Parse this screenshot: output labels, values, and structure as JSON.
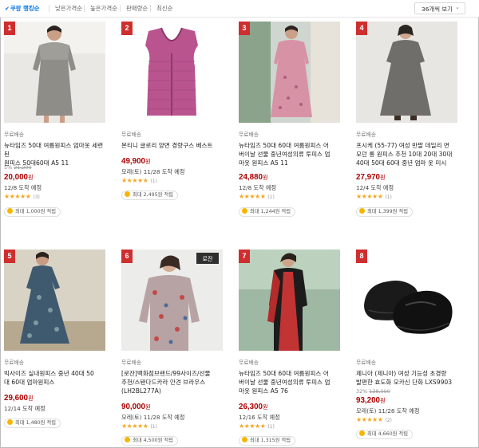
{
  "sort": {
    "options": [
      "쿠팡 랭킹순",
      "낮은가격순",
      "높은가격순",
      "판매량순",
      "최신순"
    ],
    "selected": "쿠팡 랭킹순",
    "per_page": "36개씩 보기"
  },
  "colors": {
    "accent": "#0073e9",
    "price": "#ae0000",
    "rank_badge": "#cf2e2e",
    "star": "#f5a623"
  },
  "products": [
    {
      "rank": "1",
      "shipping": "무료배송",
      "name": "뉴타임즈 50대 여름원피스 엄마옷 세련된\n원피스 50대60대 A5 11",
      "discount_pct": "5%",
      "original_price": "21,200",
      "price": "20,000",
      "won": "원",
      "delivery": "12/8 도착 예정",
      "stars": "★★★★★",
      "review_count": "(3)",
      "reward": "최대 1,000원 적립",
      "image": "gray lace dress"
    },
    {
      "rank": "2",
      "shipping": "무료배송",
      "name": "몬티니 글로리 양면 경량구스 베스트",
      "discount_pct": "",
      "original_price": "",
      "price": "49,900",
      "won": "원",
      "delivery": "모레(토) 11/28 도착 예정",
      "stars": "★★★★★",
      "review_count": "(1)",
      "reward": "최대 2,495원 적립",
      "image": "pink quilted vest"
    },
    {
      "rank": "3",
      "shipping": "무료배송",
      "name": "뉴타임즈 50대 60대 여름원피스 어\n버이날 선물 중년여성의류 투피스 엄\n마옷 원피스 A5 11",
      "discount_pct": "",
      "original_price": "",
      "price": "24,880",
      "won": "원",
      "delivery": "12/8 도착 예정",
      "stars": "★★★★★",
      "review_count": "(1)",
      "reward": "최대 1,244원 적립",
      "image": "pink floral dress"
    },
    {
      "rank": "4",
      "shipping": "무료배송",
      "name": "프시케 (55-77) 여성 반팔 데일리 면\n모던 롱 원피스 추천 10대 20대 30대\n40대 50대 60대 중년 엄마 옷 미시",
      "discount_pct": "",
      "original_price": "",
      "price": "27,970",
      "won": "원",
      "delivery": "12/4 도착 예정",
      "stars": "★★★★★",
      "review_count": "(1)",
      "reward": "최대 1,399원 적립",
      "image": "gray long dress"
    },
    {
      "rank": "5",
      "shipping": "무료배송",
      "name": "빅사이즈 실내원피스 중년 40대 50\n대 60대 엄마원피스",
      "discount_pct": "",
      "original_price": "",
      "price": "29,600",
      "won": "원",
      "delivery": "12/14 도착 예정",
      "stars": "",
      "review_count": "",
      "reward": "최대 1,480원 적립",
      "image": "blue floral dress"
    },
    {
      "rank": "6",
      "shipping": "무료배송",
      "name": "[로잔]백화점브랜드/99사이즈/선물\n추천/스탠다드카라 안견 브라우스\n(LH2BL277A)",
      "discount_pct": "",
      "original_price": "",
      "price": "90,000",
      "won": "원",
      "delivery": "모레(토) 11/28 도착 예정",
      "stars": "★★★★★",
      "review_count": "(1)",
      "reward": "최대 4,500원 적립",
      "image": "printed blouse",
      "brand_tag": "로잔"
    },
    {
      "rank": "7",
      "shipping": "무료배송",
      "name": "뉴타임즈 50대 60대 여름원피스 어\n버이날 선물 중년여성의류 투피스 엄\n마옷 원피스 A5 76",
      "discount_pct": "",
      "original_price": "",
      "price": "26,300",
      "won": "원",
      "delivery": "12/16 도착 예정",
      "stars": "★★★★★",
      "review_count": "(1)",
      "reward": "최대 1,315원 적립",
      "image": "red and black outfit"
    },
    {
      "rank": "8",
      "shipping": "무료배송",
      "name": "제니아 (제니아) 여성 기능성 초경량\n발편한 효도화 모카신 단화 LXS9903",
      "discount_pct": "32%",
      "original_price": "138,000",
      "price": "93,200",
      "won": "원",
      "delivery": "모레(토) 11/28 도착 예정",
      "stars": "★★★★★",
      "review_count": "(2)",
      "reward": "최대 4,660원 적립",
      "image": "black moccasin shoes"
    }
  ]
}
